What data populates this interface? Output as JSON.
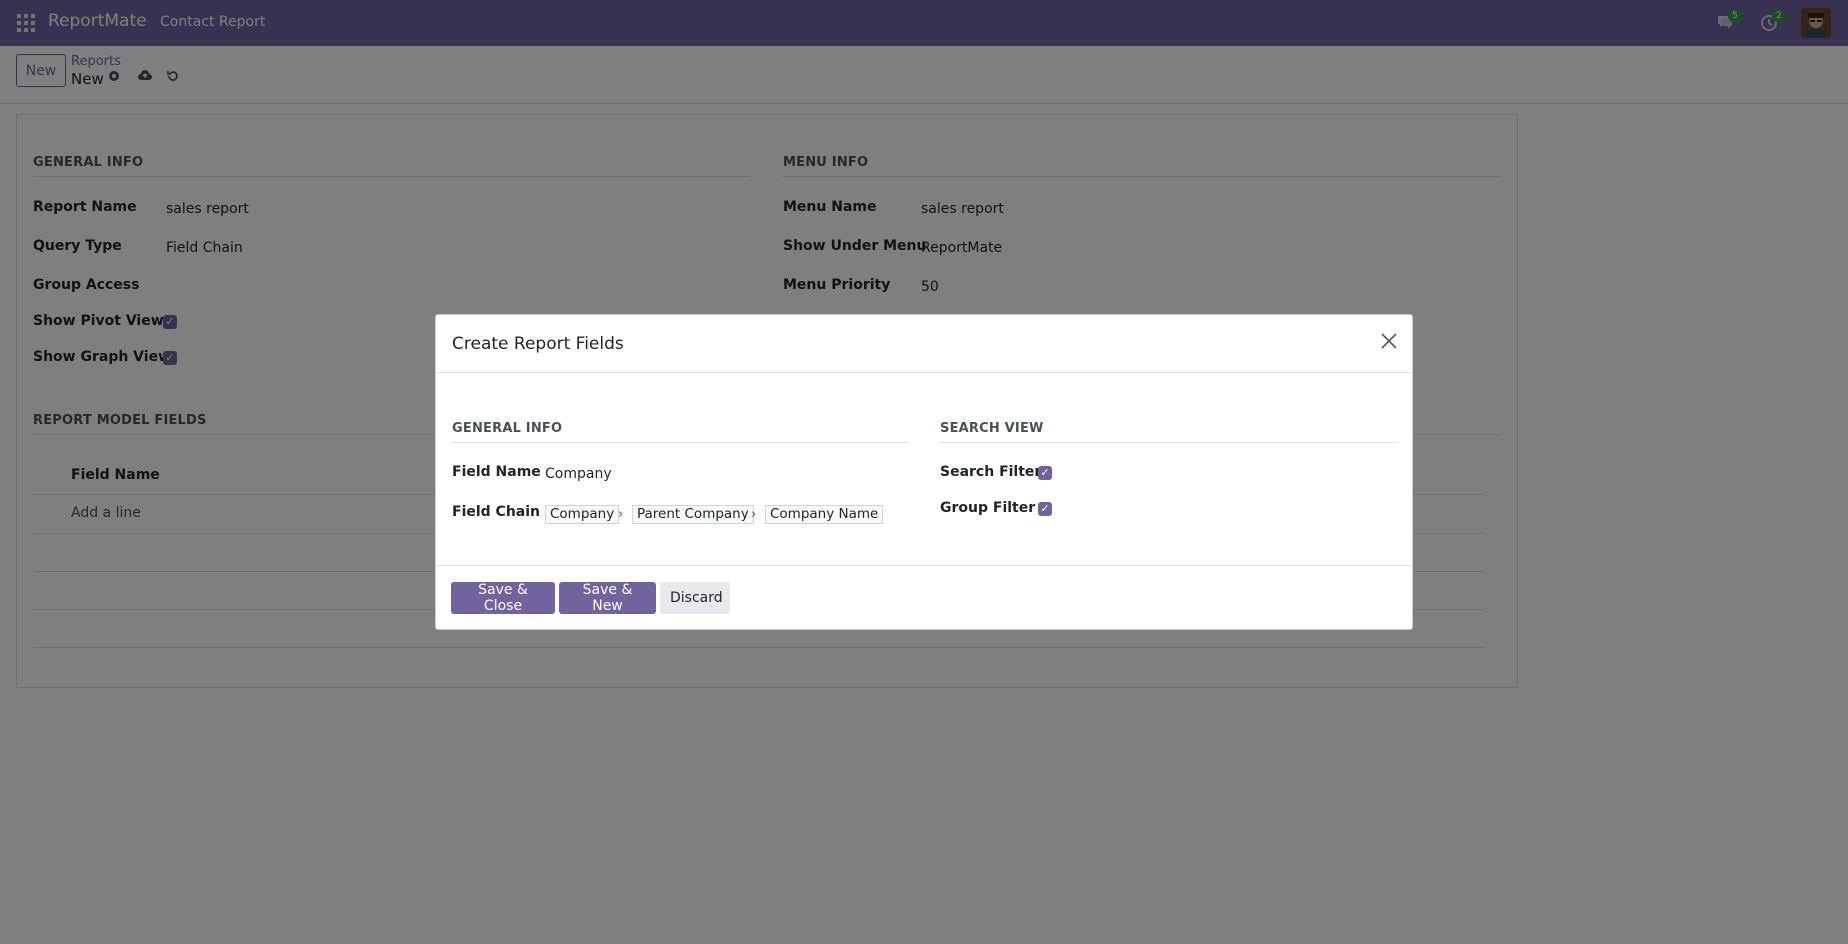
{
  "app": {
    "brand": "ReportMate",
    "menu_link": "Contact Report"
  },
  "nav": {
    "messages_count": "5",
    "activities_count": "2"
  },
  "control": {
    "new_label": "New",
    "breadcrumb": "Reports",
    "record_name": "New"
  },
  "sheet": {
    "general_info_title": "GENERAL INFO",
    "menu_info_title": "MENU INFO",
    "report_name_label": "Report Name",
    "report_name_value": "sales report",
    "query_type_label": "Query Type",
    "query_type_value": "Field Chain",
    "group_access_label": "Group Access",
    "show_pivot_label": "Show Pivot View",
    "show_graph_label": "Show Graph View",
    "menu_name_label": "Menu Name",
    "menu_name_value": "sales report",
    "show_under_menu_label": "Show Under Menu",
    "show_under_menu_value": "ReportMate",
    "menu_priority_label": "Menu Priority",
    "menu_priority_value": "50",
    "report_model_fields_title": "REPORT MODEL FIELDS",
    "col_field_name": "Field Name",
    "add_line": "Add a line"
  },
  "modal": {
    "title": "Create Report Fields",
    "general_info_title": "GENERAL INFO",
    "search_view_title": "SEARCH VIEW",
    "field_name_label": "Field Name",
    "field_name_value": "Company",
    "field_chain_label": "Field Chain",
    "field_chain": [
      "Company",
      "Parent Company",
      "Company Name"
    ],
    "search_filter_label": "Search Filter",
    "group_filter_label": "Group Filter",
    "save_close": "Save & Close",
    "save_new": "Save & New",
    "discard": "Discard"
  }
}
